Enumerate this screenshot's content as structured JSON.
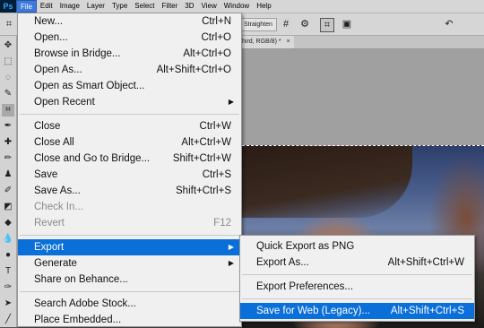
{
  "app": {
    "logo": "Ps"
  },
  "menubar": [
    "File",
    "Edit",
    "Image",
    "Layer",
    "Type",
    "Select",
    "Filter",
    "3D",
    "View",
    "Window",
    "Help"
  ],
  "options_bar": {
    "straighten_label": "Straighten"
  },
  "document_tab": {
    "title": "hird, RGB/8) *",
    "close": "×"
  },
  "file_menu": {
    "items": [
      {
        "label": "New...",
        "shortcut": "Ctrl+N"
      },
      {
        "label": "Open...",
        "shortcut": "Ctrl+O"
      },
      {
        "label": "Browse in Bridge...",
        "shortcut": "Alt+Ctrl+O"
      },
      {
        "label": "Open As...",
        "shortcut": "Alt+Shift+Ctrl+O"
      },
      {
        "label": "Open as Smart Object...",
        "shortcut": ""
      },
      {
        "label": "Open Recent",
        "shortcut": ""
      },
      {
        "label": "Close",
        "shortcut": "Ctrl+W"
      },
      {
        "label": "Close All",
        "shortcut": "Alt+Ctrl+W"
      },
      {
        "label": "Close and Go to Bridge...",
        "shortcut": "Shift+Ctrl+W"
      },
      {
        "label": "Save",
        "shortcut": "Ctrl+S"
      },
      {
        "label": "Save As...",
        "shortcut": "Shift+Ctrl+S"
      },
      {
        "label": "Check In...",
        "shortcut": ""
      },
      {
        "label": "Revert",
        "shortcut": "F12"
      },
      {
        "label": "Export",
        "shortcut": ""
      },
      {
        "label": "Generate",
        "shortcut": ""
      },
      {
        "label": "Share on Behance...",
        "shortcut": ""
      },
      {
        "label": "Search Adobe Stock...",
        "shortcut": ""
      },
      {
        "label": "Place Embedded...",
        "shortcut": ""
      }
    ]
  },
  "export_submenu": {
    "items": [
      {
        "label": "Quick Export as PNG",
        "shortcut": ""
      },
      {
        "label": "Export As...",
        "shortcut": "Alt+Shift+Ctrl+W"
      },
      {
        "label": "Export Preferences...",
        "shortcut": ""
      },
      {
        "label": "Save for Web (Legacy)...",
        "shortcut": "Alt+Shift+Ctrl+S"
      }
    ]
  },
  "icons": {
    "submenu_arrow": "▶"
  },
  "colors": {
    "highlight": "#0a6fd8",
    "menu_bg": "#f0f0f0",
    "ps_blue": "#31a8ff"
  }
}
